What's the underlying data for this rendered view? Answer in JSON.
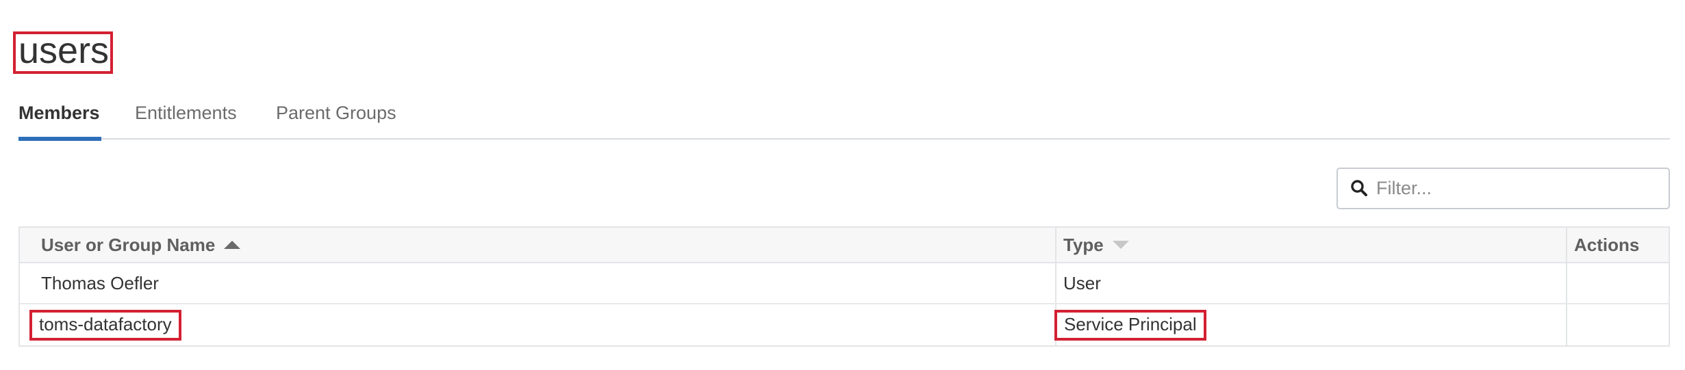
{
  "page": {
    "title": "users"
  },
  "tabs": [
    {
      "label": "Members",
      "active": true
    },
    {
      "label": "Entitlements",
      "active": false
    },
    {
      "label": "Parent Groups",
      "active": false
    }
  ],
  "filter": {
    "placeholder": "Filter...",
    "value": "",
    "icon": "search-icon"
  },
  "table": {
    "columns": {
      "name": "User or Group Name",
      "type": "Type",
      "actions": "Actions"
    },
    "sort": {
      "name": "ascending",
      "type": "unsorted"
    },
    "rows": [
      {
        "name": "Thomas Oefler",
        "type": "User"
      },
      {
        "name": "toms-datafactory",
        "type": "Service Principal"
      }
    ]
  },
  "colors": {
    "accent": "#2e6fba",
    "highlight": "#d32032"
  }
}
